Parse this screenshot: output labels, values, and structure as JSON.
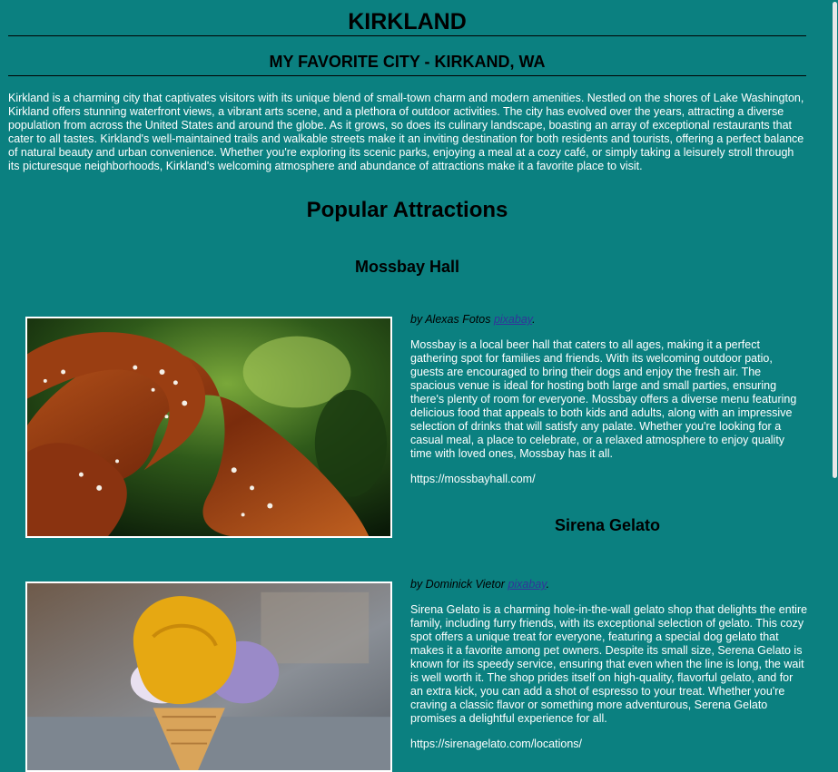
{
  "header": {
    "title": "KIRKLAND",
    "subtitle": "MY FAVORITE CITY - KIRKAND, WA"
  },
  "intro": "Kirkland is a charming city that captivates visitors with its unique blend of small-town charm and modern amenities. Nestled on the shores of Lake Washington, Kirkland offers stunning waterfront views, a vibrant arts scene, and a plethora of outdoor activities. The city has evolved over the years, attracting a diverse population from across the United States and around the globe. As it grows, so does its culinary landscape, boasting an array of exceptional restaurants that cater to all tastes. Kirkland's well-maintained trails and walkable streets make it an inviting destination for both residents and tourists, offering a perfect balance of natural beauty and urban convenience. Whether you're exploring its scenic parks, enjoying a meal at a cozy café, or simply taking a leisurely stroll through its picturesque neighborhoods, Kirkland's welcoming atmosphere and abundance of attractions make it a favorite place to visit.",
  "section_title": "Popular Attractions",
  "attractions": [
    {
      "title": "Mossbay Hall",
      "image_icon": "pretzel-photo",
      "credit_prefix": "by Alexas Fotos ",
      "credit_link": "pixabay",
      "credit_suffix": ".",
      "description": "Mossbay is a local beer hall that caters to all ages, making it a perfect gathering spot for families and friends. With its welcoming outdoor patio, guests are encouraged to bring their dogs and enjoy the fresh air. The spacious venue is ideal for hosting both large and small parties, ensuring there's plenty of room for everyone. Mossbay offers a diverse menu featuring delicious food that appeals to both kids and adults, along with an impressive selection of drinks that will satisfy any palate. Whether you're looking for a casual meal, a place to celebrate, or a relaxed atmosphere to enjoy quality time with loved ones, Mossbay has it all.",
      "url": "https://mossbayhall.com/"
    },
    {
      "title": "Sirena Gelato",
      "image_icon": "gelato-photo",
      "credit_prefix": "by Dominick Vietor ",
      "credit_link": "pixabay",
      "credit_suffix": ".",
      "description": "Sirena Gelato is a charming hole-in-the-wall gelato shop that delights the entire family, including furry friends, with its exceptional selection of gelato. This cozy spot offers a unique treat for everyone, featuring a special dog gelato that makes it a favorite among pet owners. Despite its small size, Serena Gelato is known for its speedy service, ensuring that even when the line is long, the wait is well worth it. The shop prides itself on high-quality, flavorful gelato, and for an extra kick, you can add a shot of espresso to your treat. Whether you're craving a classic flavor or something more adventurous, Serena Gelato promises a delightful experience for all.",
      "url": "https://sirenagelato.com/locations/"
    }
  ],
  "colors": {
    "background": "#0b8080",
    "heading": "#000000",
    "body_text": "#ffffff",
    "link": "#333399"
  }
}
